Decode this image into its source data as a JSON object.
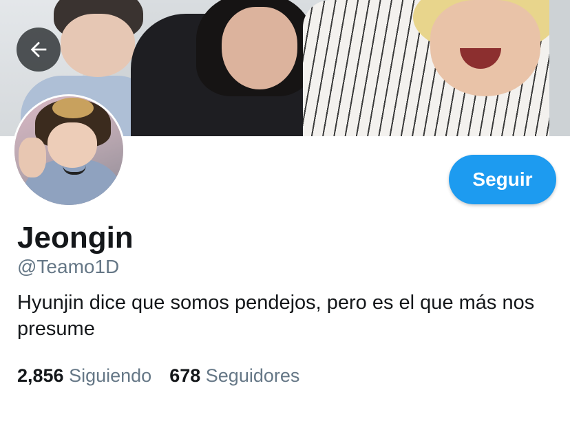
{
  "header": {
    "back_icon": "arrow-left-icon"
  },
  "profile": {
    "display_name": "Jeongin",
    "handle": "@Teamo1D",
    "bio": "Hyunjin dice que somos pendejos, pero es el que más nos presume",
    "follow_label": "Seguir",
    "accent_color": "#1d9bf0"
  },
  "stats": {
    "following_count": "2,856",
    "following_label": "Siguiendo",
    "followers_count": "678",
    "followers_label": "Seguidores"
  }
}
